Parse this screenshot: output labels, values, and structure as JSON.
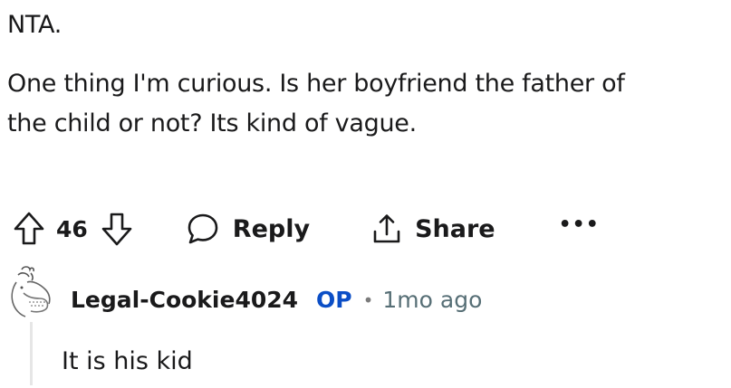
{
  "comment": {
    "line1": "NTA.",
    "line2a": "One thing I'm curious. Is her boyfriend the father of",
    "line2b": "the child or not? Its kind of vague."
  },
  "actions": {
    "upvote_icon": "upvote-arrow-icon",
    "vote_count": "46",
    "downvote_icon": "downvote-arrow-icon",
    "reply_icon": "speech-bubble-icon",
    "reply_label": "Reply",
    "share_icon": "share-icon",
    "share_label": "Share",
    "more_label": "•••"
  },
  "reply": {
    "avatar_icon": "avatar-illustration",
    "username": "Legal-Cookie4024",
    "op_badge": "OP",
    "separator": "•",
    "time": "1mo ago",
    "text": "It is his kid"
  },
  "colors": {
    "text": "#1a1a1b",
    "op_badge": "#0b4ec6",
    "meta": "#576f76",
    "thread_line": "#e6e6e6"
  }
}
